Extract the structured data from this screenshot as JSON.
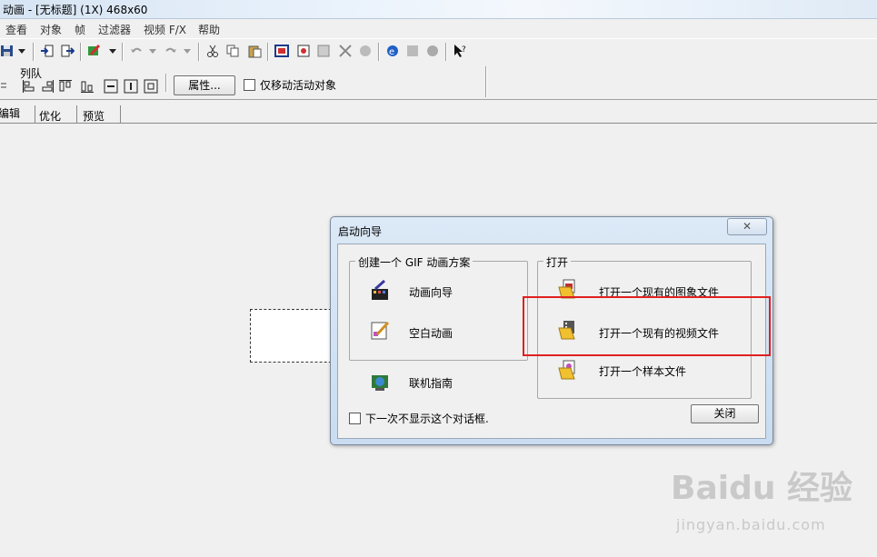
{
  "window": {
    "title": "动画 - [无标题] (1X) 468x60"
  },
  "menu": [
    "查看",
    "对象",
    "帧",
    "过滤器",
    "视频 F/X",
    "帮助"
  ],
  "toolbar2": {
    "queue_label": "列队",
    "properties_button": "属性...",
    "move_active_label": "仅移动活动对象"
  },
  "tabs": [
    "编辑",
    "优化",
    "预览"
  ],
  "dialog": {
    "title": "启动向导",
    "close_x": "✕",
    "create_group": {
      "title": "创建一个 GIF 动画方案",
      "items": [
        "动画向导",
        "空白动画"
      ]
    },
    "online_guide": "联机指南",
    "open_group": {
      "title": "打开",
      "items": [
        "打开一个现有的图象文件",
        "打开一个现有的视频文件",
        "打开一个样本文件"
      ]
    },
    "dont_show_label": "下一次不显示这个对话框.",
    "close_button": "关闭"
  },
  "watermark": {
    "main": "Baidu 经验",
    "sub": "jingyan.baidu.com"
  },
  "colors": {
    "highlight": "#e02020",
    "dialog_frame": "#c9dcf0"
  }
}
